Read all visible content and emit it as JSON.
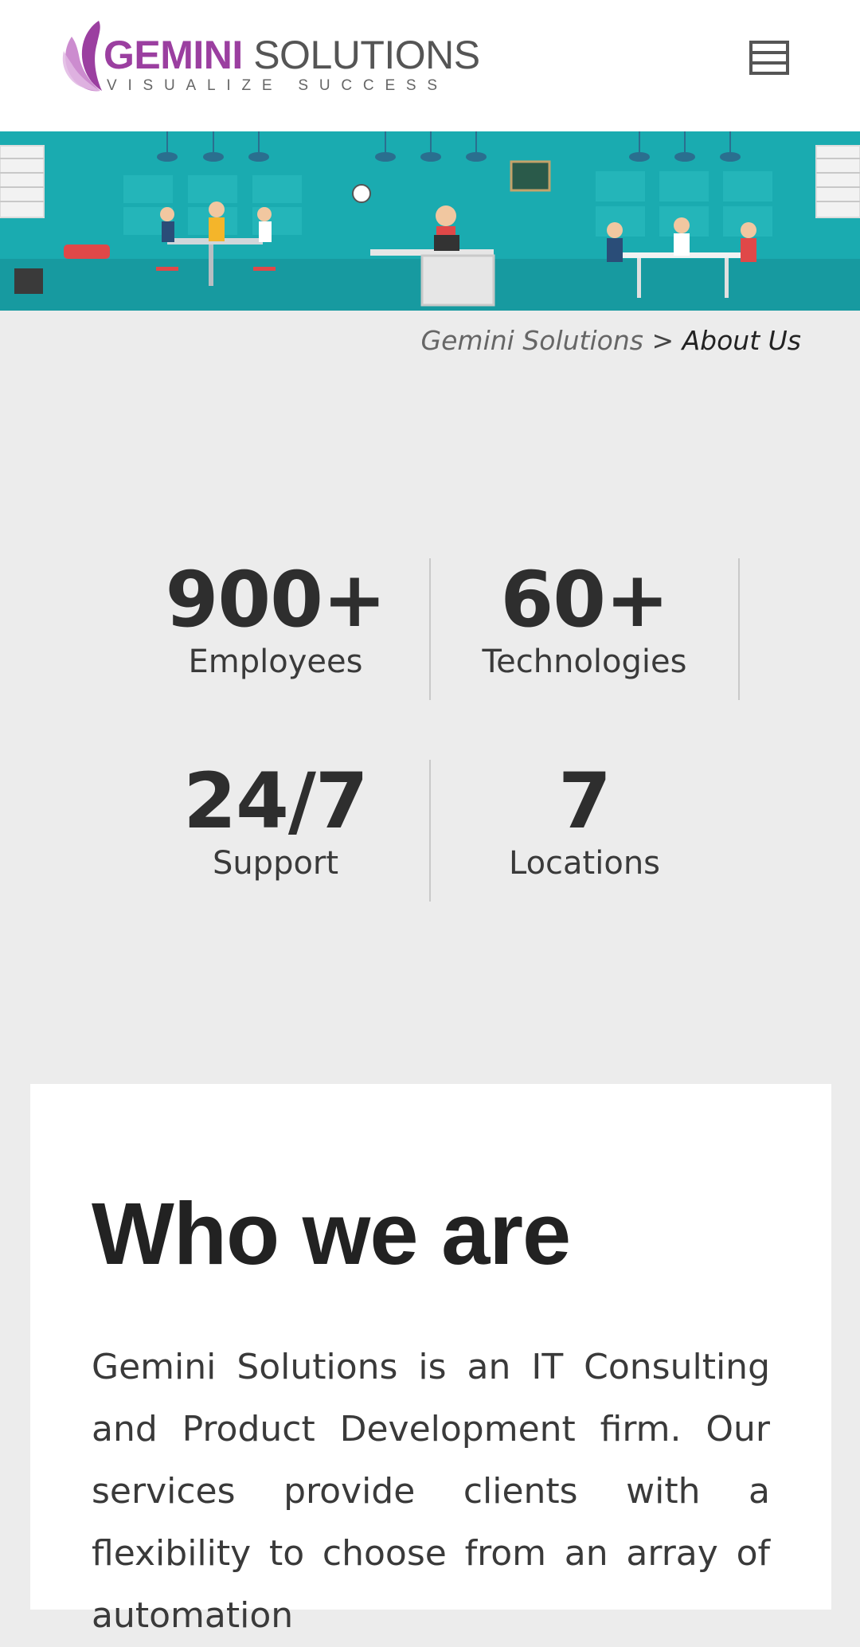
{
  "header": {
    "logo_word_1": "GEMINI",
    "logo_word_2": "SOLUTIONS",
    "logo_tagline": "VISUALIZE SUCCESS",
    "menu_icon": "hamburger-menu-icon"
  },
  "banner": {
    "illustration": "office-teamwork-illustration"
  },
  "breadcrumb": {
    "home": "Gemini Solutions",
    "separator": ">",
    "current": "About Us"
  },
  "stats": [
    {
      "value": "900+",
      "label": "Employees"
    },
    {
      "value": "60+",
      "label": "Technologies"
    },
    {
      "value": "24/7",
      "label": "Support"
    },
    {
      "value": "7",
      "label": "Locations"
    }
  ],
  "about": {
    "title": "Who we are",
    "body": "Gemini Solutions is an IT Consulting and Product Development firm. Our services provide clients with a flexibility to choose from an array of automation"
  },
  "colors": {
    "brand_purple": "#9b3fa0",
    "banner_teal": "#1aabb0",
    "page_bg": "#ececec"
  }
}
